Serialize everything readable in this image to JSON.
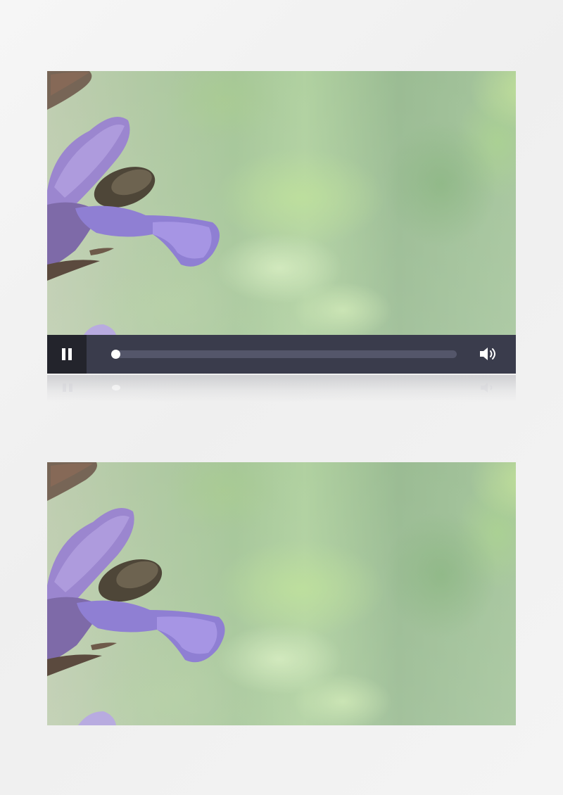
{
  "video_player": {
    "state": "playing",
    "play_toggle_icon": "pause-icon",
    "progress": 0.0,
    "volume_icon": "volume-icon",
    "muted": false
  },
  "second_frame": {
    "content": "video-still"
  },
  "colors": {
    "control_bar": "#3a3c4c",
    "play_button_bg": "#23242c",
    "progress_track": "#54566a",
    "progress_thumb": "#ffffff",
    "icon": "#ffffff",
    "page_background": "#f2f2f2"
  }
}
